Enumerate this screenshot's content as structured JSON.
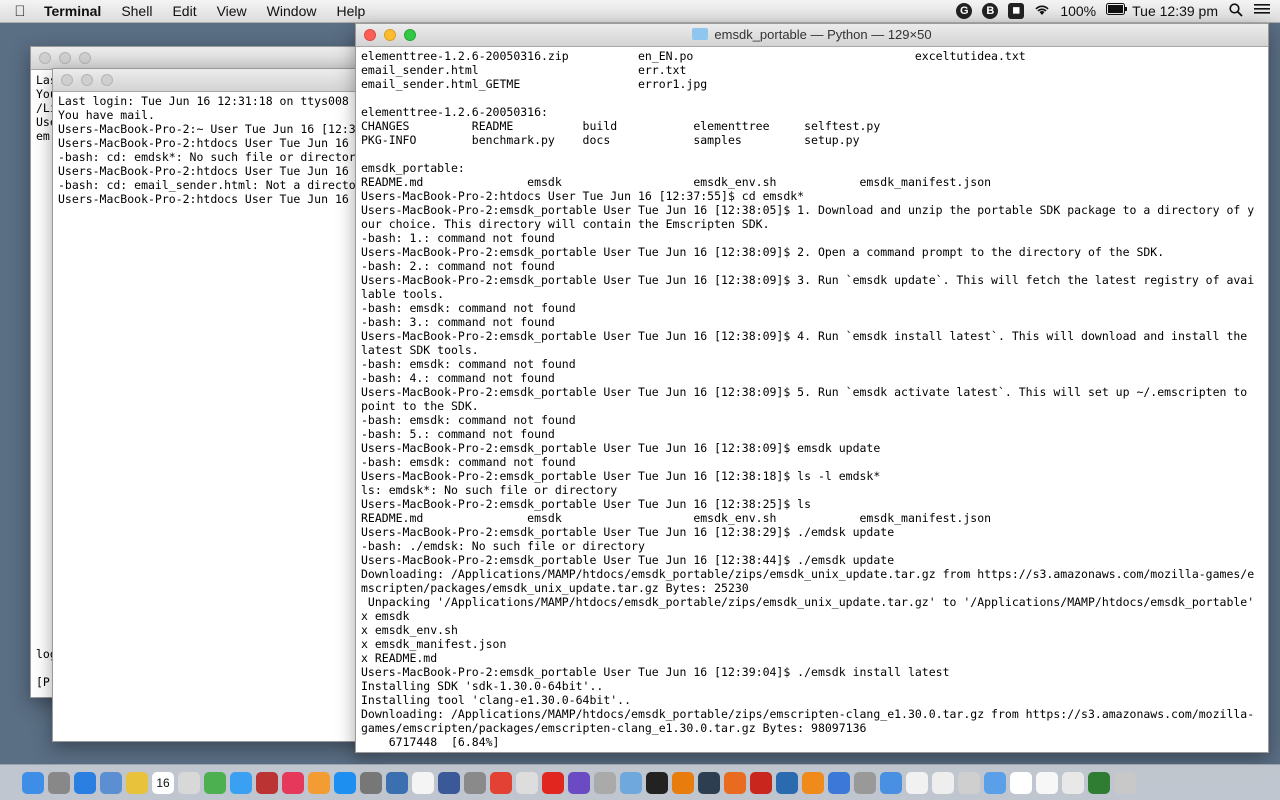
{
  "menubar": {
    "apple": "",
    "app_name": "Terminal",
    "items": [
      "Shell",
      "Edit",
      "View",
      "Window",
      "Help"
    ],
    "battery": "100%",
    "clock": "Tue 12:39 pm"
  },
  "back_window": {
    "frag_lines": [
      "Las",
      "You",
      "/Li",
      "Use",
      " em"
    ],
    "frag_bottom1": "log",
    "frag_bottom2": "[P"
  },
  "back_window2": {
    "text": "Last login: Tue Jun 16 12:31:18 on ttys008\nYou have mail.\nUsers-MacBook-Pro-2:~ User Tue Jun 16 [12:3\nUsers-MacBook-Pro-2:htdocs User Tue Jun 16\n-bash: cd: emdsk*: No such file or director\nUsers-MacBook-Pro-2:htdocs User Tue Jun 16\n-bash: cd: email_sender.html: Not a directo\nUsers-MacBook-Pro-2:htdocs User Tue Jun 16"
  },
  "main_window": {
    "title": "emsdk_portable — Python — 129×50",
    "text": "elementtree-1.2.6-20050316.zip          en_EN.po                                exceltutidea.txt\nemail_sender.html                       err.txt\nemail_sender.html_GETME                 error1.jpg\n\nelementtree-1.2.6-20050316:\nCHANGES         README          build           elementtree     selftest.py\nPKG-INFO        benchmark.py    docs            samples         setup.py\n\nemsdk_portable:\nREADME.md               emsdk                   emsdk_env.sh            emsdk_manifest.json\nUsers-MacBook-Pro-2:htdocs User Tue Jun 16 [12:37:55]$ cd emsdk*\nUsers-MacBook-Pro-2:emsdk_portable User Tue Jun 16 [12:38:05]$ 1. Download and unzip the portable SDK package to a directory of y\nour choice. This directory will contain the Emscripten SDK.\n-bash: 1.: command not found\nUsers-MacBook-Pro-2:emsdk_portable User Tue Jun 16 [12:38:09]$ 2. Open a command prompt to the directory of the SDK.\n-bash: 2.: command not found\nUsers-MacBook-Pro-2:emsdk_portable User Tue Jun 16 [12:38:09]$ 3. Run `emsdk update`. This will fetch the latest registry of avai\nlable tools.\n-bash: emsdk: command not found\n-bash: 3.: command not found\nUsers-MacBook-Pro-2:emsdk_portable User Tue Jun 16 [12:38:09]$ 4. Run `emsdk install latest`. This will download and install the\nlatest SDK tools.\n-bash: emsdk: command not found\n-bash: 4.: command not found\nUsers-MacBook-Pro-2:emsdk_portable User Tue Jun 16 [12:38:09]$ 5. Run `emsdk activate latest`. This will set up ~/.emscripten to\npoint to the SDK.\n-bash: emsdk: command not found\n-bash: 5.: command not found\nUsers-MacBook-Pro-2:emsdk_portable User Tue Jun 16 [12:38:09]$ emsdk update\n-bash: emsdk: command not found\nUsers-MacBook-Pro-2:emsdk_portable User Tue Jun 16 [12:38:18]$ ls -l emdsk*\nls: emdsk*: No such file or directory\nUsers-MacBook-Pro-2:emsdk_portable User Tue Jun 16 [12:38:25]$ ls\nREADME.md               emsdk                   emsdk_env.sh            emsdk_manifest.json\nUsers-MacBook-Pro-2:emsdk_portable User Tue Jun 16 [12:38:29]$ ./emdsk update\n-bash: ./emdsk: No such file or directory\nUsers-MacBook-Pro-2:emsdk_portable User Tue Jun 16 [12:38:44]$ ./emsdk update\nDownloading: /Applications/MAMP/htdocs/emsdk_portable/zips/emsdk_unix_update.tar.gz from https://s3.amazonaws.com/mozilla-games/e\nmscripten/packages/emsdk_unix_update.tar.gz Bytes: 25230\n Unpacking '/Applications/MAMP/htdocs/emsdk_portable/zips/emsdk_unix_update.tar.gz' to '/Applications/MAMP/htdocs/emsdk_portable'\nx emsdk\nx emsdk_env.sh\nx emsdk_manifest.json\nx README.md\nUsers-MacBook-Pro-2:emsdk_portable User Tue Jun 16 [12:39:04]$ ./emsdk install latest\nInstalling SDK 'sdk-1.30.0-64bit'..\nInstalling tool 'clang-e1.30.0-64bit'..\nDownloading: /Applications/MAMP/htdocs/emsdk_portable/zips/emscripten-clang_e1.30.0.tar.gz from https://s3.amazonaws.com/mozilla-\ngames/emscripten/packages/emscripten-clang_e1.30.0.tar.gz Bytes: 98097136\n    6717448  [6.84%]"
  },
  "dock": {
    "calendar_day": "16",
    "icons": [
      "finder-icon",
      "launchpad-icon",
      "safari-icon",
      "preview-icon",
      "notes-icon",
      "calendar-icon",
      "photos-icon",
      "facetime-icon",
      "messages-icon",
      "photobooth-icon",
      "itunes-icon",
      "ibooks-icon",
      "appstore-icon",
      "systemprefs-icon",
      "xcode-icon",
      "textedit-icon",
      "bbedit-icon",
      "automator-icon",
      "chrome-icon",
      "files-icon",
      "opera-icon",
      "imovie-icon",
      "script-icon",
      "mail-icon",
      "terminal-icon",
      "blender-icon",
      "bbedit2-icon",
      "firefox-icon",
      "filezilla-icon",
      "camino-icon",
      "vlc-icon",
      "screenshot-icon",
      "help-icon",
      "cube-icon",
      "pages-icon",
      "textfile-icon",
      "dictionary-icon",
      "downloads-icon",
      "folder-icon",
      "folder2-icon",
      "folder3-icon",
      "terminal2-icon",
      "trash-icon"
    ],
    "colors": {
      "finder": "#3e8ee8",
      "safari": "#2a7fe0",
      "chrome": "#e34133",
      "opera": "#e0261e",
      "itunes": "#e5385a",
      "firefox": "#e96b1f",
      "filezilla": "#c9271e",
      "vlc": "#f08a1a",
      "terminal": "#222222",
      "trash": "#c8c8c8"
    }
  }
}
